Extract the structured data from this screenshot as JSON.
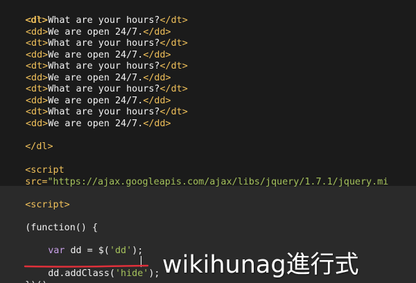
{
  "colors": {
    "tag": "#f0c05a",
    "text": "#f4f4f4",
    "string": "#a5c25c",
    "keyword": "#c8a0e8",
    "underline": "#e0303a",
    "background_top": "#1b1b1b",
    "background_bottom": "#2a2a2a"
  },
  "code": {
    "dl_open": "<dl>",
    "items": [
      {
        "dt_open": "<dt>",
        "q": "What are your hours?",
        "dt_close": "</dt>"
      },
      {
        "dd_open": "<dd>",
        "a": "We are open 24/7.",
        "dd_close": "</dd>"
      },
      {
        "dt_open": "<dt>",
        "q": "What are your hours?",
        "dt_close": "</dt>"
      },
      {
        "dd_open": "<dd>",
        "a": "We are open 24/7.",
        "dd_close": "</dd>"
      },
      {
        "dt_open": "<dt>",
        "q": "What are your hours?",
        "dt_close": "</dt>"
      },
      {
        "dd_open": "<dd>",
        "a": "We are open 24/7.",
        "dd_close": "</dd>"
      },
      {
        "dt_open": "<dt>",
        "q": "What are your hours?",
        "dt_close": "</dt>"
      },
      {
        "dd_open": "<dd>",
        "a": "We are open 24/7.",
        "dd_close": "</dd>"
      },
      {
        "dt_open": "<dt>",
        "q": "What are your hours?",
        "dt_close": "</dt>"
      },
      {
        "dd_open": "<dd>",
        "a": "We are open 24/7.",
        "dd_close": "</dd>"
      }
    ],
    "dl_close": "</dl>",
    "script_src_tag": "<script",
    "script_src_attr": "src=",
    "script_src_value": "\"https://ajax.googleapis.com/ajax/libs/jquery/1.7.1/jquery.mi",
    "script_open": "<script>",
    "iife_open": "(function() {",
    "var_keyword": "var",
    "var_name": " dd = $(",
    "var_string": "'dd'",
    "var_end": ");",
    "call_prefix": "dd.addClass(",
    "call_string": "'hide'",
    "call_end": ");",
    "iife_close": "})();"
  },
  "watermark": "wikihunag進行式"
}
